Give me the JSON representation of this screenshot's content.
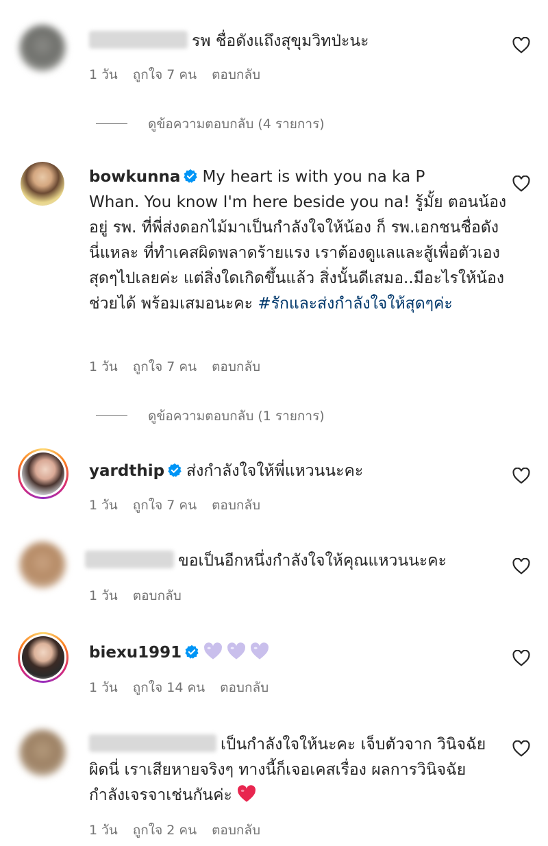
{
  "colors": {
    "text": "#262626",
    "meta": "#737373",
    "hashtag": "#00376b",
    "verified": "#0095f6",
    "red_heart": "#e8264f",
    "lavender_heart": "#c9bfec"
  },
  "comments": [
    {
      "username": "",
      "text": "รพ ชื่อดังแถึงสุขุมวิทป่ะนะ",
      "time": "1 วัน",
      "likes": "ถูกใจ 7 คน",
      "reply": "ตอบกลับ",
      "view_replies": "ดูข้อความตอบกลับ (4 รายการ)"
    },
    {
      "username": "bowkunna",
      "text_line1": "My heart is with you na ka P",
      "text_rest": "Whan. You know I'm here beside you na! รู้มั้ย ตอนน้องอยู่ รพ. ที่พี่ส่งดอกไม้มาเป็นกำลังใจให้น้อง ก็ รพ.เอกชนชื่อดังนี่แหละ ที่ทำเคสผิดพลาดร้ายแรง เราต้องดูแลและสู้เพื่อตัวเองสุดๆไปเลยค่ะ แต่สิ่งใดเกิดขึ้นแล้ว สิ่งนั้นดีเสมอ..มีอะไรให้น้องช่วยได้ พร้อมเสมอนะคะ",
      "hashtag": "#รักและส่งกำลังใจให้สุดๆค่ะ",
      "time": "1 วัน",
      "likes": "ถูกใจ 7 คน",
      "reply": "ตอบกลับ",
      "view_replies": "ดูข้อความตอบกลับ (1 รายการ)"
    },
    {
      "username": "yardthip",
      "text": "ส่งกำลังใจให้พี่แหวนนะคะ",
      "time": "1 วัน",
      "likes": "ถูกใจ 7 คน",
      "reply": "ตอบกลับ"
    },
    {
      "username": "",
      "text": "ขอเป็นอีกหนึ่งกำลังใจให้คุณแหวนนะคะ",
      "time": "1 วัน",
      "reply": "ตอบกลับ"
    },
    {
      "username": "biexu1991",
      "emoji": "lavender-heart-icon x3",
      "time": "1 วัน",
      "likes": "ถูกใจ 14 คน",
      "reply": "ตอบกลับ"
    },
    {
      "username": "",
      "text": "เป็นกำลังใจให้นะคะ เจ็บตัวจาก วินิจฉัยผิดนี่ เราเสียหายจริงๆ ทางนี้ก็เจอเคสเรื่อง ผลการวินิจฉัย กำลังเจรจาเช่นกันค่ะ",
      "emoji": "red-heart-icon",
      "time": "1 วัน",
      "likes": "ถูกใจ 2 คน",
      "reply": "ตอบกลับ"
    }
  ]
}
